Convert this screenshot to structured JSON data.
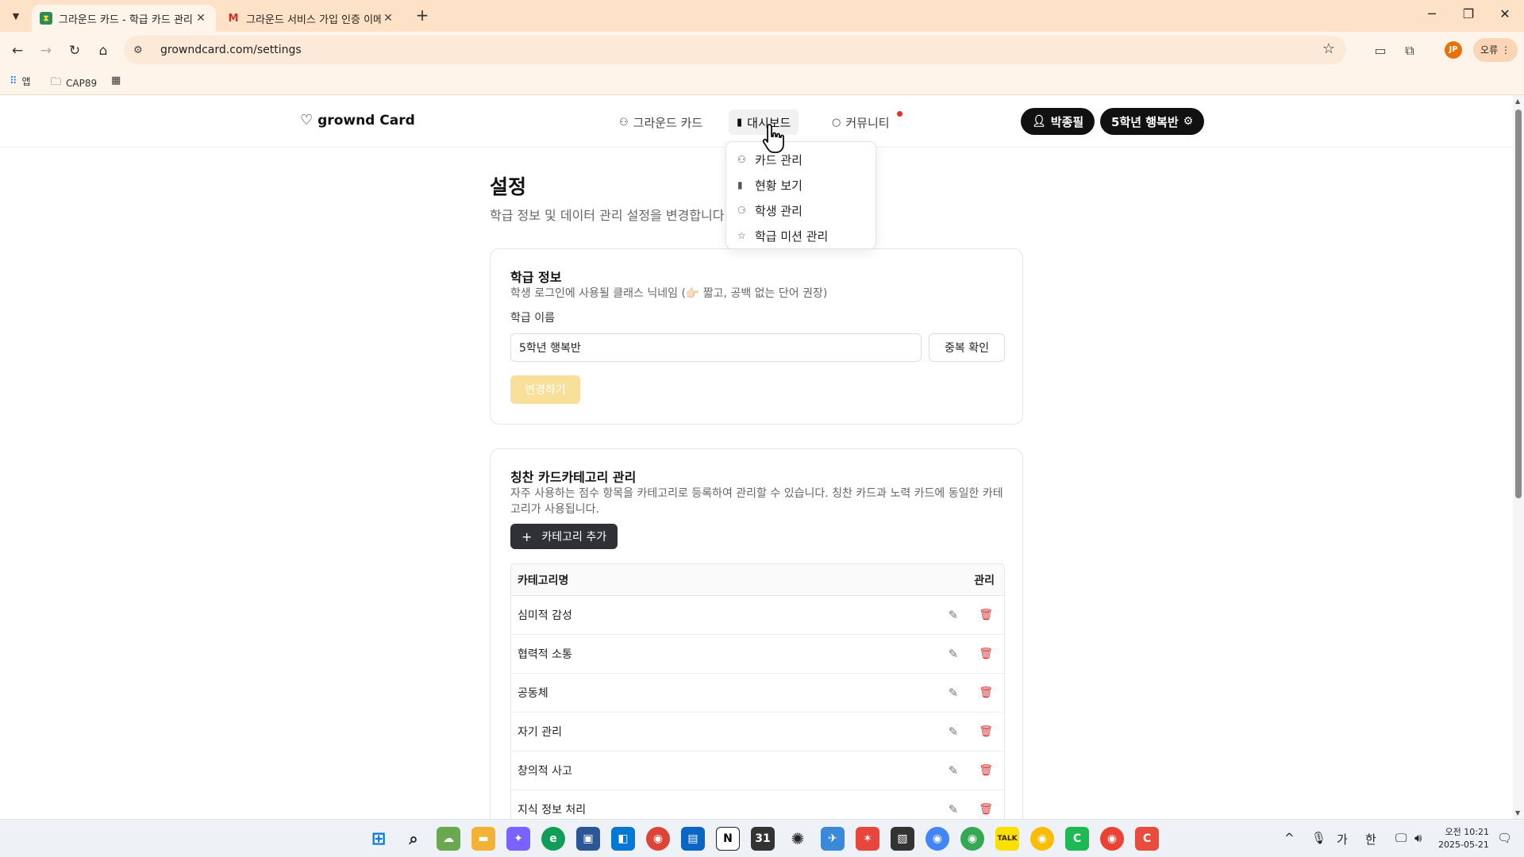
{
  "browser": {
    "tabs": [
      {
        "title": "그라운드 카드 - 학급 카드 관리",
        "active": true
      },
      {
        "title": "그라운드 서비스 가입 인증 이메일",
        "active": false
      }
    ],
    "new_tab": "+",
    "url": "growndcard.com/settings",
    "bookmarks": [
      {
        "label": "앱",
        "icon": "apps-grid-icon"
      },
      {
        "label": "CAP89",
        "icon": "folder-icon"
      }
    ],
    "profile_initials": "JP",
    "error_label": "오류"
  },
  "site": {
    "logo": "grownd Card",
    "nav": [
      {
        "label": "그라운드 카드",
        "icon": "cards-icon"
      },
      {
        "label": "대시보드",
        "icon": "bar-chart-icon"
      },
      {
        "label": "커뮤니티",
        "icon": "chat-icon"
      }
    ],
    "user_button": "박종필",
    "class_button": "5학년 행복반"
  },
  "dropdown": [
    {
      "label": "카드 관리",
      "icon": "cards-icon"
    },
    {
      "label": "현황 보기",
      "icon": "bar-chart-icon"
    },
    {
      "label": "학생 관리",
      "icon": "students-icon"
    },
    {
      "label": "학급 미션 관리",
      "icon": "star-icon"
    }
  ],
  "page": {
    "title": "설정",
    "description": "학급 정보 및 데이터 관리 설정을 변경합니다."
  },
  "class_info": {
    "title": "학급 정보",
    "description": "학생 로그인에 사용될 클래스 닉네임 (👉🏻 짧고, 공백 없는 단어 권장)",
    "field_label": "학급 이름",
    "field_value": "5학년 행복반",
    "check_button": "중복 확인",
    "save_button": "변경하기"
  },
  "category": {
    "title": "칭찬 카드카테고리 관리",
    "description": "자주 사용하는 점수 항목을 카테고리로 등록하여 관리할 수 있습니다. 칭찬 카드과 노력 카드에 동일한 카테고리가 사용됩니다.",
    "add_button": "카테고리 추가",
    "col_name": "카테고리명",
    "col_actions": "관리",
    "rows": [
      "심미적 감성",
      "협력적 소통",
      "공동체",
      "자기 관리",
      "창의적 사고",
      "지식 정보 처리"
    ]
  },
  "system": {
    "clock_time": "오전 10:21",
    "clock_date": "2025-05-21",
    "ime_ga": "가",
    "ime_han": "한"
  },
  "colors": {
    "tabbar": "#fde2c7",
    "accent_yellow": "#f8e09a",
    "danger": "#e03131",
    "dark": "#111111"
  }
}
